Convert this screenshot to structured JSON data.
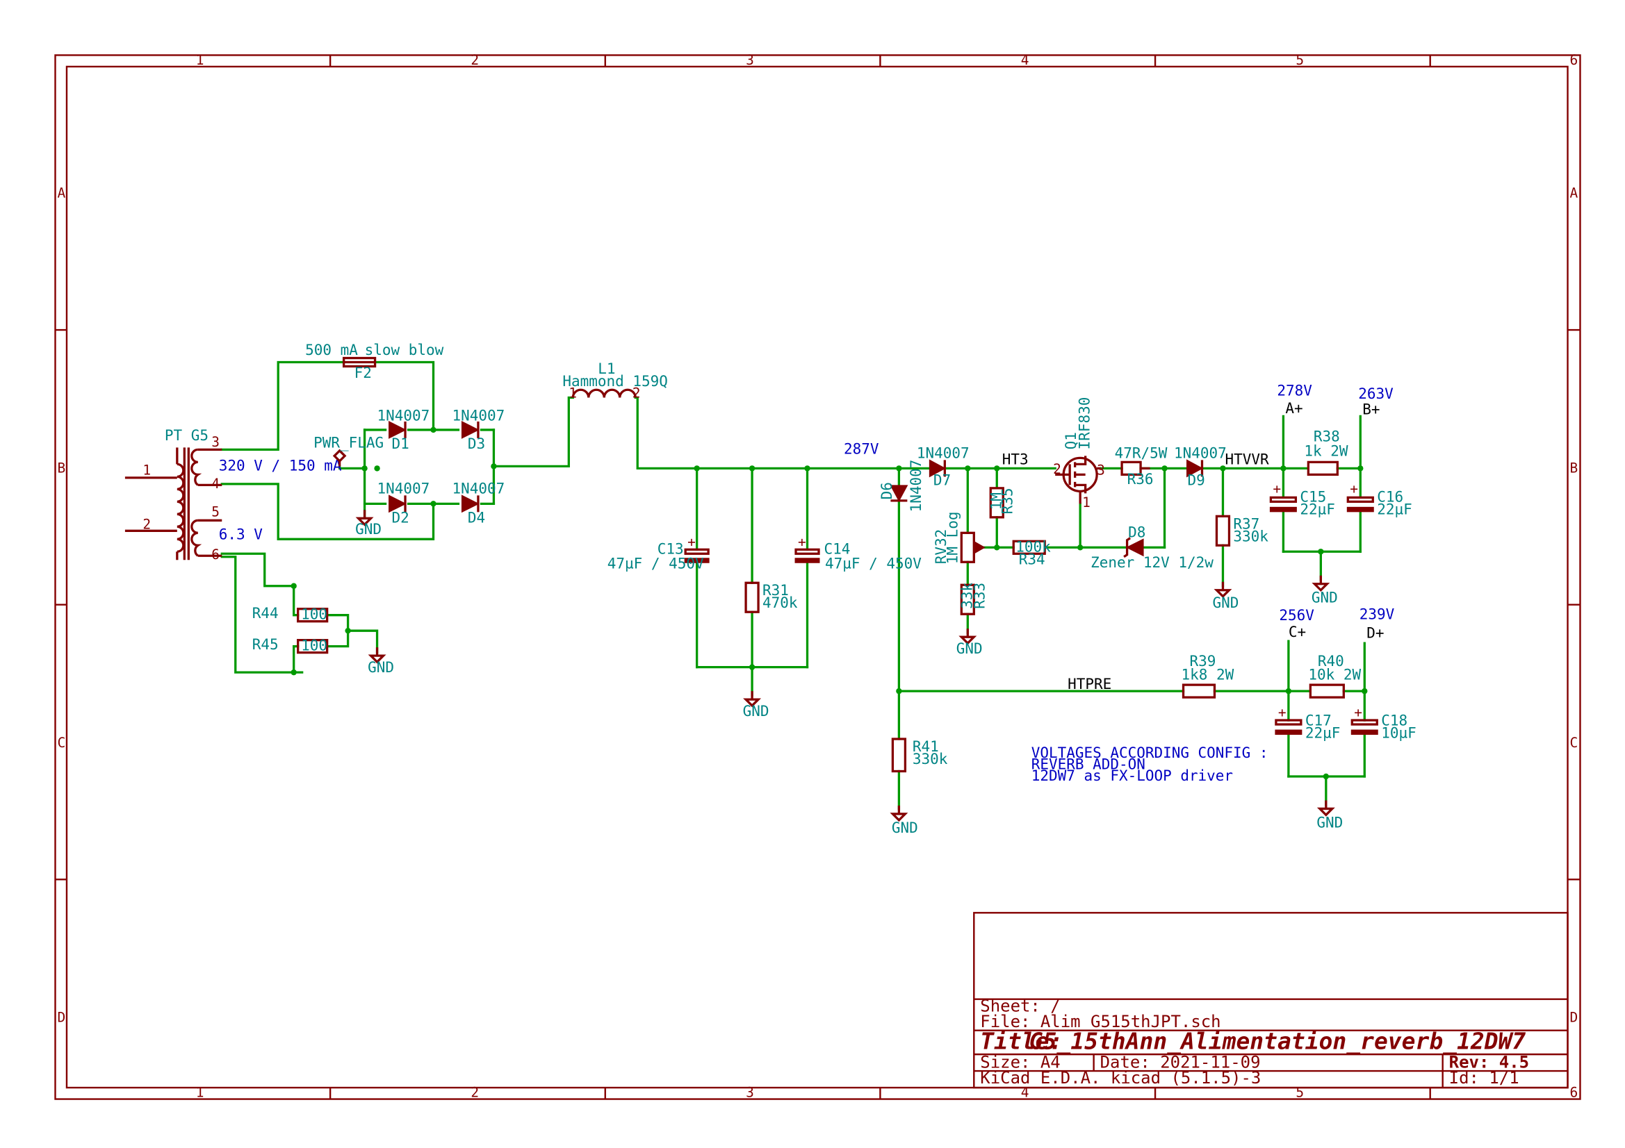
{
  "frame": {
    "col_labels": [
      "1",
      "2",
      "3",
      "4",
      "5",
      "6"
    ],
    "row_labels": [
      "A",
      "B",
      "C",
      "D"
    ]
  },
  "title_block": {
    "sheet": "Sheet: /",
    "file": "File: Alim_G515thJPT.sch",
    "title_prefix": "Title:",
    "title": "G5_15thAnn_Alimentation_reverb_12DW7",
    "size": "Size: A4",
    "date": "Date: 2021-11-09",
    "rev": "Rev: 4.5",
    "tool": "KiCad E.D.A.  kicad (5.1.5)-3",
    "id": "Id: 1/1"
  },
  "transformer": {
    "ref": "PT G5",
    "secondary_hv": "320 V / 150 mA",
    "secondary_lv": "6.3 V",
    "pins": [
      "1",
      "2",
      "3",
      "4",
      "5",
      "6"
    ]
  },
  "fuse": {
    "value": "500 mA",
    "note": "slow blow",
    "ref": "F2"
  },
  "pwr_flag": "PWR_FLAG",
  "diodes": {
    "d1": {
      "ref": "D1",
      "value": "1N4007"
    },
    "d2": {
      "ref": "D2",
      "value": "1N4007"
    },
    "d3": {
      "ref": "D3",
      "value": "1N4007"
    },
    "d4": {
      "ref": "D4",
      "value": "1N4007"
    },
    "d6": {
      "ref": "D6",
      "value": "1N4007"
    },
    "d7": {
      "ref": "D7",
      "value": "1N4007"
    },
    "d8": {
      "ref": "D8",
      "value": "Zener 12V 1/2w"
    },
    "d9": {
      "ref": "D9",
      "value": "1N4007"
    }
  },
  "inductor": {
    "ref": "L1",
    "value": "Hammond 159Q",
    "pin1": "1",
    "pin2": "2"
  },
  "capacitors": {
    "c13": {
      "ref": "C13",
      "value": "47µF / 450V"
    },
    "c14": {
      "ref": "C14",
      "value": "47µF / 450V"
    },
    "c15": {
      "ref": "C15",
      "value": "22µF"
    },
    "c16": {
      "ref": "C16",
      "value": "22µF"
    },
    "c17": {
      "ref": "C17",
      "value": "22µF"
    },
    "c18": {
      "ref": "C18",
      "value": "10µF"
    }
  },
  "resistors": {
    "r31": {
      "ref": "R31",
      "value": "470k"
    },
    "r33": {
      "ref": "R33",
      "value": "33k"
    },
    "r34": {
      "ref": "R34",
      "value": "100k"
    },
    "r35": {
      "ref": "R35",
      "value": "1M"
    },
    "r36": {
      "ref": "R36",
      "value": "47R/5W"
    },
    "r37": {
      "ref": "R37",
      "value": "330k"
    },
    "r38": {
      "ref": "R38",
      "value": "1k  2W"
    },
    "r39": {
      "ref": "R39",
      "value": "1k8 2W"
    },
    "r40": {
      "ref": "R40",
      "value": "10k 2W"
    },
    "r41": {
      "ref": "R41",
      "value": "330k"
    },
    "r44": {
      "ref": "R44",
      "value": "100"
    },
    "r45": {
      "ref": "R45",
      "value": "100"
    }
  },
  "pot": {
    "ref": "RV32",
    "value": "1M Log"
  },
  "mosfet": {
    "ref": "Q1",
    "value": "IRF830",
    "pin1": "1",
    "pin2": "2",
    "pin3": "3"
  },
  "gnd": "GND",
  "nets": {
    "ht3": "HT3",
    "htvvr": "HTVVR",
    "htpre": "HTPRE",
    "aplus": "A+",
    "bplus": "B+",
    "cplus": "C+",
    "dplus": "D+"
  },
  "voltages": {
    "v287": "287V",
    "v278": "278V",
    "v263": "263V",
    "v256": "256V",
    "v239": "239V"
  },
  "note": [
    "VOLTAGES ACCORDING CONFIG :",
    "REVERB ADD-ON",
    "12DW7 as FX-LOOP driver"
  ]
}
